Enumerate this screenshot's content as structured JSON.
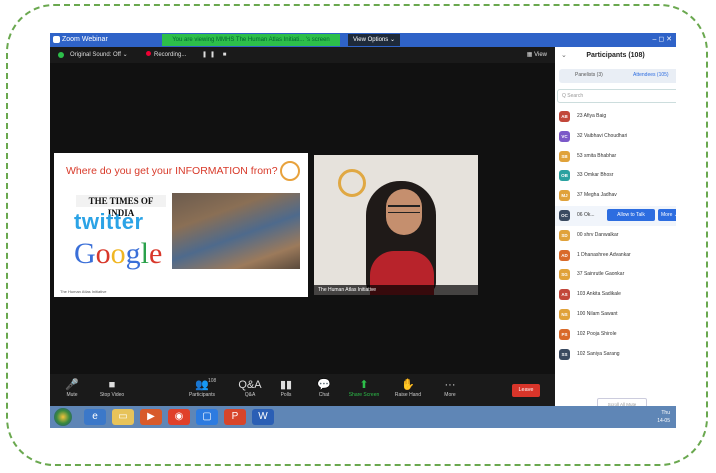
{
  "window": {
    "title": "Zoom Webinar",
    "controls": "– ◻ ✕"
  },
  "share_banner": "You are viewing MMHS The Human Atlas Initiati... 's screen",
  "view_options": "View Options ⌄",
  "toolbar": {
    "original_sound": "Original Sound: Off  ⌄",
    "recording": "Recording...",
    "recording_controls": "❚❚ ■",
    "view": "▦ View"
  },
  "slide": {
    "title": "Where do you get your INFORMATION from?",
    "times": "THE TIMES OF INDIA",
    "twitter": "twitter",
    "google": [
      "G",
      "o",
      "o",
      "g",
      "l",
      "e"
    ],
    "google_colors": [
      "#3a6fd8",
      "#d8372a",
      "#f0b622",
      "#3a6fd8",
      "#2aa14a",
      "#d8372a"
    ],
    "caption": "The Human Atlas Initiative"
  },
  "speaker": {
    "name": "The Human Atlas Initiative"
  },
  "participants": {
    "title": "Participants (108)",
    "tabs": [
      "Panelists (3)",
      "Attendees (105)"
    ],
    "search_placeholder": "Q Search",
    "rows": [
      {
        "initials": "AB",
        "name": "23 Afiya Baig",
        "color": "#c2473a"
      },
      {
        "initials": "VC",
        "name": "32 Vaibhavi Choudhari",
        "color": "#7b58c8"
      },
      {
        "initials": "SB",
        "name": "53 smita Bhabhar",
        "color": "#e0a23a"
      },
      {
        "initials": "OB",
        "name": "33 Omkar Bhosr",
        "color": "#2aa1a0"
      },
      {
        "initials": "MJ",
        "name": "37 Megha Jadhav",
        "color": "#e0a23a"
      },
      {
        "initials": "OC",
        "name": "06 Ok...",
        "color": "#3a4a60",
        "allow": "Allow to Talk",
        "more": "More ⌄"
      },
      {
        "initials": "SD",
        "name": "00 shrv Danwalkar",
        "color": "#e0a23a"
      },
      {
        "initials": "AD",
        "name": "1 Dhanashree Advankar",
        "color": "#d96a2a"
      },
      {
        "initials": "SG",
        "name": "37 Sainrutle Gaonkar",
        "color": "#e0a23a"
      },
      {
        "initials": "AS",
        "name": "103 Ankita Sadikale",
        "color": "#c2473a"
      },
      {
        "initials": "NS",
        "name": "100 Nilam Sawant",
        "color": "#e0a23a"
      },
      {
        "initials": "PS",
        "name": "102 Pooja Shirole",
        "color": "#d96a2a"
      },
      {
        "initials": "SS",
        "name": "102 Saniya Sarang",
        "color": "#3a4a60"
      }
    ],
    "scroll_all": "Scroll All Mute"
  },
  "controls": [
    {
      "icon": "🎤",
      "label": "Mute",
      "name": "mute"
    },
    {
      "icon": "■",
      "label": "Stop Video",
      "name": "stop-video"
    },
    {
      "icon": "👥",
      "label": "Participants",
      "name": "participants"
    },
    {
      "icon": "Q&A",
      "label": "Q&A",
      "name": "qa"
    },
    {
      "icon": "▮▮",
      "label": "Polls",
      "name": "polls"
    },
    {
      "icon": "💬",
      "label": "Chat",
      "name": "chat"
    },
    {
      "icon": "⬆",
      "label": "Share Screen",
      "name": "share-screen"
    },
    {
      "icon": "✋",
      "label": "Raise Hand",
      "name": "raise-hand"
    },
    {
      "icon": "···",
      "label": "More",
      "name": "more"
    }
  ],
  "participants_count": "108",
  "leave": "Leave",
  "taskbar": {
    "time": "Thu",
    "date": "14-05"
  }
}
